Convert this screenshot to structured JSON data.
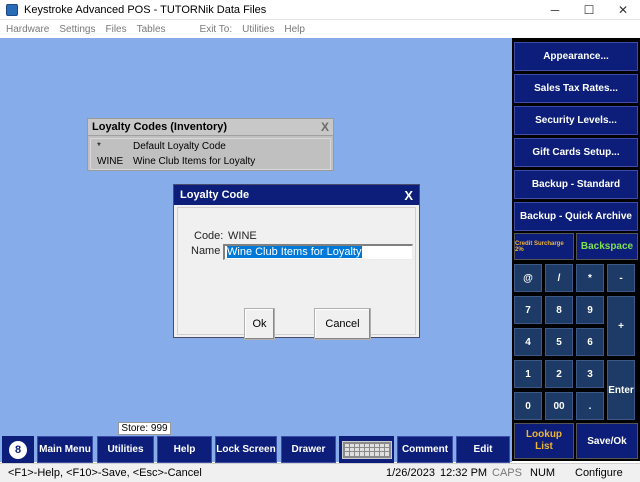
{
  "window": {
    "title": "Keystroke Advanced POS - TUTORNik Data Files",
    "minimize": "─",
    "maximize": "☐",
    "close": "✕"
  },
  "menu": {
    "items": [
      "Hardware",
      "Settings",
      "Files",
      "Tables",
      "Exit To:",
      "Utilities",
      "Help"
    ]
  },
  "loyalty_list": {
    "title": "Loyalty Codes (Inventory)",
    "close": "X",
    "rows": [
      {
        "code": "*",
        "description": "Default Loyalty Code"
      },
      {
        "code": "WINE",
        "description": "Wine Club Items for Loyalty"
      }
    ]
  },
  "dialog": {
    "title": "Loyalty Code",
    "close": "X",
    "code_label": "Code:",
    "code_value": "WINE",
    "name_label": "Name",
    "name_value": "Wine Club Items for Loyalty",
    "ok": "Ok",
    "cancel": "Cancel"
  },
  "function_buttons": [
    "Appearance...",
    "Sales Tax Rates...",
    "Security Levels...",
    "Gift Cards Setup...",
    "Backup - Standard",
    "Backup - Quick Archive"
  ],
  "credit_surcharge": "Credit Surcharge 2%",
  "backspace": "Backspace",
  "keypad": {
    "row1": [
      "@",
      "/",
      "*",
      "-"
    ],
    "row2": [
      "7",
      "8",
      "9"
    ],
    "row3": [
      "4",
      "5",
      "6"
    ],
    "row4": [
      "1",
      "2",
      "3"
    ],
    "row5": [
      "0",
      "00",
      "."
    ],
    "plus": "+",
    "enter": "Enter"
  },
  "lookup": "Lookup\nList",
  "save_ok": "Save/Ok",
  "store": "Store: 999",
  "taskbar": {
    "logo": "8",
    "main_menu": "Main Menu",
    "utilities": "Utilities",
    "help": "Help",
    "lock_screen": "Lock Screen",
    "drawer": "Drawer",
    "comment": "Comment",
    "edit": "Edit"
  },
  "status": {
    "hint": "<F1>-Help, <F10>-Save, <Esc>-Cancel",
    "date": "1/26/2023",
    "time": "12:32 PM",
    "caps": "CAPS",
    "num": "NUM",
    "configure": "Configure"
  },
  "colors": {
    "workspace": "#87acea",
    "button_navy": "#0c1e7a",
    "key_blue": "#1d3b66",
    "lookup_orange": "#f0b530",
    "selection": "#0078d7"
  }
}
